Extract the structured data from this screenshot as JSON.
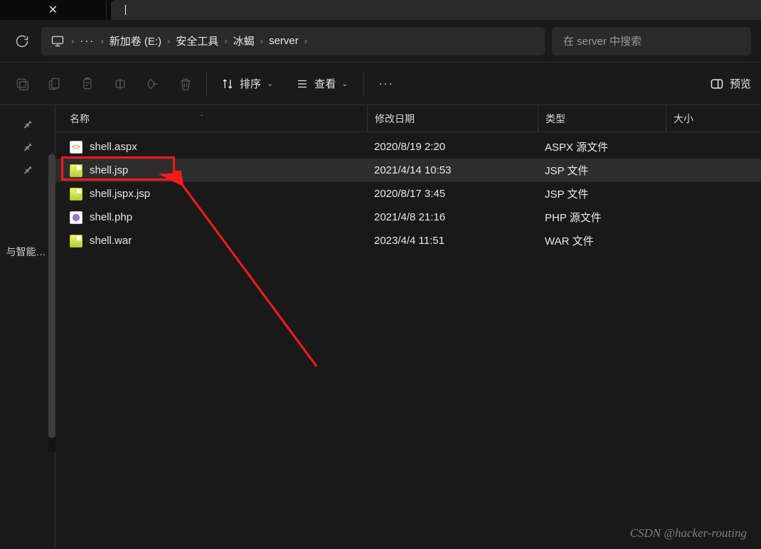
{
  "tabbar": {
    "close_label": "×"
  },
  "address": {
    "crumbs": [
      "新加卷 (E:)",
      "安全工具",
      "冰蝎",
      "server"
    ]
  },
  "search": {
    "placeholder": "在 server 中搜索"
  },
  "toolbar": {
    "sort_label": "排序",
    "view_label": "查看",
    "preview_label": "预览"
  },
  "sidebar": {
    "section_label": "与智能…"
  },
  "columns": {
    "name": "名称",
    "date": "修改日期",
    "type": "类型",
    "size": "大小"
  },
  "files": [
    {
      "name": "shell.aspx",
      "date": "2020/8/19 2:20",
      "type": "ASPX 源文件",
      "icon": "aspx"
    },
    {
      "name": "shell.jsp",
      "date": "2021/4/14 10:53",
      "type": "JSP 文件",
      "icon": "jsp",
      "selected": true
    },
    {
      "name": "shell.jspx.jsp",
      "date": "2020/8/17 3:45",
      "type": "JSP 文件",
      "icon": "jsp"
    },
    {
      "name": "shell.php",
      "date": "2021/4/8 21:16",
      "type": "PHP 源文件",
      "icon": "php"
    },
    {
      "name": "shell.war",
      "date": "2023/4/4 11:51",
      "type": "WAR 文件",
      "icon": "jsp"
    }
  ],
  "watermark": "CSDN @hacker-routing"
}
